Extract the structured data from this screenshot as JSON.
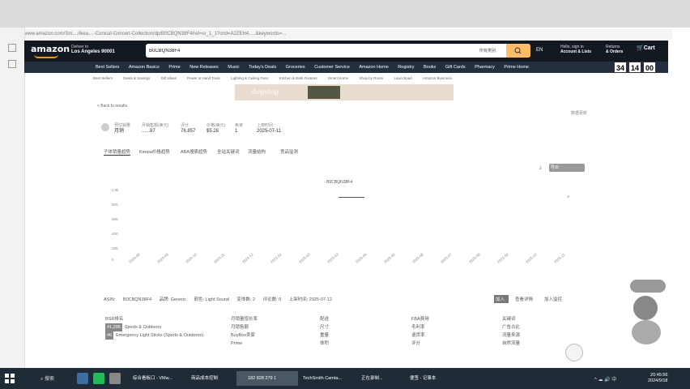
{
  "browser": {
    "url": "www.amazon.com/Sm..../Ikea....-Conical-Concert-Collection/dp/B0CBQN38F4/ref=sr_1_1?crid=A2ZEH4.....&keywords=..."
  },
  "amazon": {
    "logo": "amazon",
    "deliver_to": "Deliver to",
    "location": "Los Angeles 90001",
    "search_value": "B0CBQN38F4",
    "search_category": "所有类别",
    "language": "EN",
    "signin_line1": "Hello, sign in",
    "signin_line2": "Account & Lists",
    "orders_line1": "Returns",
    "orders_line2": "& Orders",
    "cart": "Cart",
    "nav": [
      "Best Sellers",
      "Amazon Basics",
      "Prime",
      "New Releases",
      "Music",
      "Today's Deals",
      "Groceries",
      "Customer Service",
      "Amazon Home",
      "Registry",
      "Books",
      "Gift Cards",
      "Pharmacy",
      "Prime Home"
    ],
    "timer": [
      "34",
      "14",
      "00"
    ],
    "subnav": [
      "Best Sellers",
      "Deals & Savings",
      "Gift Ideas",
      "Power & Hand Tools",
      "Lighting & Ceiling Fans",
      "Kitchen & Bath Fixtures",
      "Smart Home",
      "Shop by Room",
      "Launchpad",
      "Amazon Business"
    ],
    "banner": "shopshop"
  },
  "panel": {
    "back_link": "< Back to results",
    "top_right": "数据更新",
    "stats": [
      {
        "label": "预估销量",
        "value": "月销"
      },
      {
        "label": "月销售额(美元)",
        "value": "......87"
      },
      {
        "label": "评分",
        "value": "76,857"
      },
      {
        "label": "价格(美元)",
        "value": "$5.28"
      },
      {
        "label": "卖家",
        "value": "1"
      },
      {
        "label": "上架时间",
        "value": "2025-07-11"
      }
    ],
    "tabs": [
      "子体销量趋势",
      "Keepa价格趋势",
      "ABA搜索趋势",
      "全站关键词",
      "流量结构",
      "竞品监测"
    ],
    "chart_button": "导出",
    "legend": "B0CBQN38F4",
    "y_ticks": [
      "1.0k",
      "800",
      "600",
      "400",
      "200",
      "0"
    ],
    "x_ticks": [
      "2024-08",
      "2024-09",
      "2024-10",
      "2024-11",
      "2024-12",
      "2025-01",
      "2025-02",
      "2025-03",
      "2025-04",
      "2025-05",
      "2025-06",
      "2025-07",
      "2025-08",
      "2025-09",
      "2025-10",
      "2025-11"
    ]
  },
  "info_row": [
    "ASIN:",
    "B0CBQN38F4",
    "品牌: Generic",
    "颜色: Light Sound",
    "变体数: 2",
    "评论数: 0",
    "上架时间: 2025-07-12"
  ],
  "actions": [
    "加入",
    "查看详情",
    "加入监控"
  ],
  "categories": {
    "title": "BSR排名",
    "items": [
      {
        "tag": "#1,295",
        "name": "Sports & Outdoors"
      },
      {
        "tag": "#6",
        "name": "Emergency Light Sticks (Sports & Outdoors)"
      }
    ],
    "col2": [
      "月销量增长率",
      "月销售额",
      "BuyBox卖家",
      "Prime"
    ],
    "col3": [
      "配送",
      "尺寸",
      "重量",
      "体积"
    ],
    "col4": [
      "FBA费用",
      "毛利率",
      "退货率",
      "评分"
    ],
    "col5": [
      "关键词",
      "广告占比",
      "流量来源",
      "自然流量"
    ]
  },
  "taskbar": {
    "search": "搜索",
    "items": [
      "综合看板口 - VMw...",
      "商品成本控制",
      "182 828 279 1",
      "TechSmith Camta...",
      "正在录制...",
      "便签 - 记事本"
    ],
    "time": "20:45:56",
    "date": "2024/9/18"
  },
  "colors": {
    "amazon_dark": "#131921",
    "amazon_nav": "#232f3e",
    "amazon_orange": "#febd69",
    "taskbar": "#1f2b36"
  }
}
